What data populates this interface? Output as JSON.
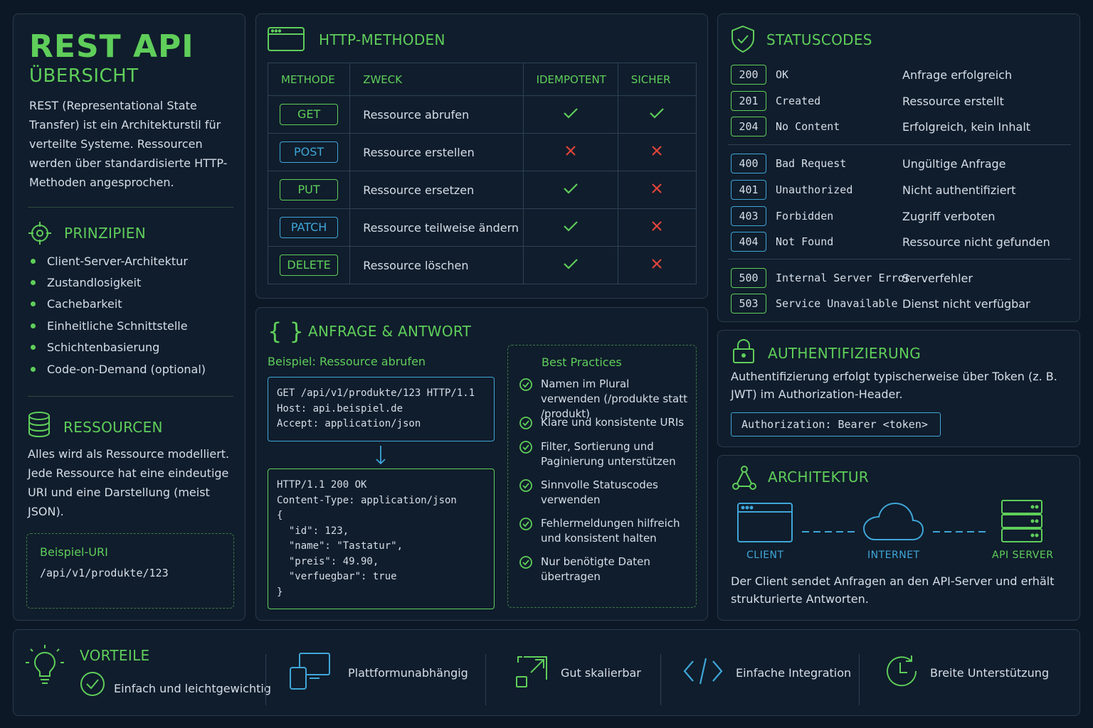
{
  "overview": {
    "title": "REST API",
    "subtitle": "ÜBERSICHT",
    "intro": "REST (Representational State Transfer) ist ein Architekturstil für verteilte Systeme. Ressourcen werden über standardisierte HTTP-Methoden angesprochen.",
    "principles_title": "PRINZIPIEN",
    "principles": [
      "Client-Server-Architektur",
      "Zustandlosigkeit",
      "Cachebarkeit",
      "Einheitliche Schnittstelle",
      "Schichtenbasierung",
      "Code-on-Demand (optional)"
    ],
    "resources_title": "RESSOURCEN",
    "resources_text": "Alles wird als Ressource modelliert. Jede Ressource hat eine eindeutige URI und eine Darstellung (meist JSON).",
    "example_uri_label": "Beispiel-URI",
    "example_uri": "/api/v1/produkte/123"
  },
  "methods": {
    "title": "HTTP-METHODEN",
    "headers": [
      "METHODE",
      "ZWECK",
      "IDEMPOTENT",
      "SICHER"
    ],
    "rows": [
      {
        "method": "GET",
        "purpose": "Ressource abrufen",
        "idempotent": true,
        "safe": true,
        "color": "#5fce5a"
      },
      {
        "method": "POST",
        "purpose": "Ressource erstellen",
        "idempotent": false,
        "safe": false,
        "color": "#3fa6d8"
      },
      {
        "method": "PUT",
        "purpose": "Ressource ersetzen",
        "idempotent": true,
        "safe": false,
        "color": "#5fce5a"
      },
      {
        "method": "PATCH",
        "purpose": "Ressource teilweise ändern",
        "idempotent": true,
        "safe": false,
        "color": "#3fa6d8"
      },
      {
        "method": "DELETE",
        "purpose": "Ressource löschen",
        "idempotent": true,
        "safe": false,
        "color": "#5fce5a"
      }
    ]
  },
  "reqres": {
    "title": "ANFRAGE & ANTWORT",
    "example_label": "Beispiel: Ressource abrufen",
    "request": "GET /api/v1/produkte/123 HTTP/1.1\nHost: api.beispiel.de\nAccept: application/json",
    "response": "HTTP/1.1 200 OK\nContent-Type: application/json\n{\n  \"id\": 123,\n  \"name\": \"Tastatur\",\n  \"preis\": 49.90,\n  \"verfuegbar\": true\n}",
    "best_practices_title": "Best Practices",
    "best_practices": [
      "Namen im Plural verwenden (/produkte statt /produkt)",
      "Klare und konsistente URIs",
      "Filter, Sortierung und Paginierung unterstützen",
      "Sinnvolle Statuscodes verwenden",
      "Fehlermeldungen hilfreich und konsistent halten",
      "Nur benötigte Daten übertragen"
    ]
  },
  "status": {
    "title": "STATUSCODES",
    "codes": [
      {
        "code": "200",
        "name": "OK",
        "desc": "Anfrage erfolgreich",
        "color": "#5fce5a"
      },
      {
        "code": "201",
        "name": "Created",
        "desc": "Ressource erstellt",
        "color": "#5fce5a"
      },
      {
        "code": "204",
        "name": "No Content",
        "desc": "Erfolgreich, kein Inhalt",
        "color": "#5fce5a"
      },
      {
        "code": "400",
        "name": "Bad Request",
        "desc": "Ungültige Anfrage",
        "color": "#3fa6d8"
      },
      {
        "code": "401",
        "name": "Unauthorized",
        "desc": "Nicht authentifiziert",
        "color": "#3fa6d8"
      },
      {
        "code": "403",
        "name": "Forbidden",
        "desc": "Zugriff verboten",
        "color": "#3fa6d8"
      },
      {
        "code": "404",
        "name": "Not Found",
        "desc": "Ressource nicht gefunden",
        "color": "#3fa6d8"
      },
      {
        "code": "500",
        "name": "Internal Server Error",
        "desc": "Serverfehler",
        "color": "#5fce5a"
      },
      {
        "code": "503",
        "name": "Service Unavailable",
        "desc": "Dienst nicht verfügbar",
        "color": "#5fce5a"
      }
    ]
  },
  "auth": {
    "title": "AUTHENTIFIZIERUNG",
    "text": "Authentifizierung erfolgt typischerweise über Token (z. B. JWT) im Authorization-Header.",
    "header_example": "Authorization: Bearer <token>"
  },
  "architecture": {
    "title": "ARCHITEKTUR",
    "client": "CLIENT",
    "internet": "INTERNET",
    "server": "API SERVER",
    "text": "Der Client sendet Anfragen an den API-Server und erhält strukturierte Antworten."
  },
  "advantages": {
    "title": "VORTEILE",
    "items": [
      {
        "label": "Einfach und leichtgewichtig",
        "icon": "check-circle-icon"
      },
      {
        "label": "Plattformunabhängig",
        "icon": "devices-icon"
      },
      {
        "label": "Gut skalierbar",
        "icon": "scale-icon"
      },
      {
        "label": "Einfache Integration",
        "icon": "code-icon"
      },
      {
        "label": "Breite Unterstützung",
        "icon": "clock-icon"
      }
    ]
  },
  "colors": {
    "green": "#5fce5a",
    "blue": "#3fa6d8",
    "red": "#e0453a",
    "background": "#0d1826"
  }
}
